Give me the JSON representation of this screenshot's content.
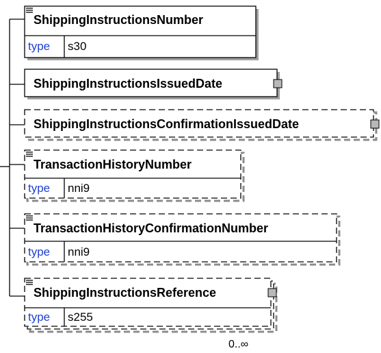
{
  "elements": [
    {
      "name": "ShippingInstructionsNumber",
      "type_label": "type",
      "type_value": "s30",
      "optional": false,
      "has_children": false
    },
    {
      "name": "ShippingInstructionsIssuedDate",
      "optional": false,
      "has_children": true
    },
    {
      "name": "ShippingInstructionsConfirmationIssuedDate",
      "optional": true,
      "has_children": true
    },
    {
      "name": "TransactionHistoryNumber",
      "type_label": "type",
      "type_value": "nni9",
      "optional": true,
      "has_children": false
    },
    {
      "name": "TransactionHistoryConfirmationNumber",
      "type_label": "type",
      "type_value": "nni9",
      "optional": true,
      "has_children": false
    },
    {
      "name": "ShippingInstructionsReference",
      "type_label": "type",
      "type_value": "s255",
      "optional": true,
      "has_children": true,
      "occurrence": "0..∞"
    }
  ]
}
